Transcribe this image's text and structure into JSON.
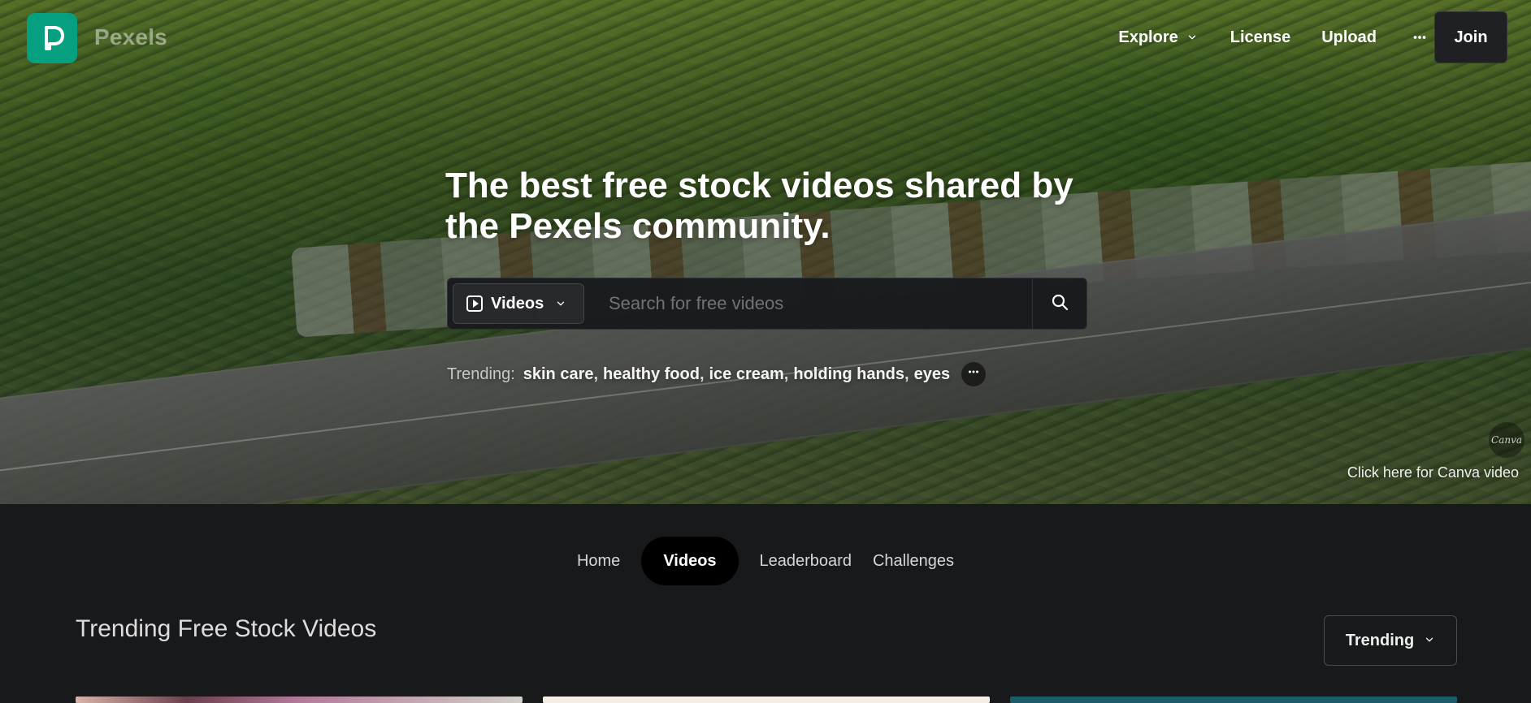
{
  "brand": {
    "name": "Pexels",
    "logo_color": "#06a081"
  },
  "top_nav": {
    "items": [
      {
        "label": "Explore",
        "icon": "chevron-down-icon"
      },
      {
        "label": "License"
      },
      {
        "label": "Upload"
      },
      {
        "label": "",
        "icon": "more-dots-icon"
      }
    ],
    "join_label": "Join"
  },
  "hero": {
    "headline": "The best free stock videos shared by the Pexels community.",
    "search": {
      "type_label": "Videos",
      "type_icon": "play-square-icon",
      "placeholder": "Search for free videos",
      "search_icon": "search-icon"
    },
    "trending": {
      "label": "Trending:",
      "tags": [
        "skin care",
        "healthy food",
        "ice cream",
        "holding hands",
        "eyes"
      ],
      "more_icon": "more-dots-icon"
    },
    "canva": {
      "badge_text": "Canva",
      "link_text": "Click here for Canva video"
    }
  },
  "tabs": [
    {
      "label": "Home",
      "active": false
    },
    {
      "label": "Videos",
      "active": true
    },
    {
      "label": "Leaderboard",
      "active": false
    },
    {
      "label": "Challenges",
      "active": false
    }
  ],
  "section": {
    "title": "Trending Free Stock Videos",
    "sort_label": "Trending",
    "sort_icon": "chevron-down-icon"
  }
}
